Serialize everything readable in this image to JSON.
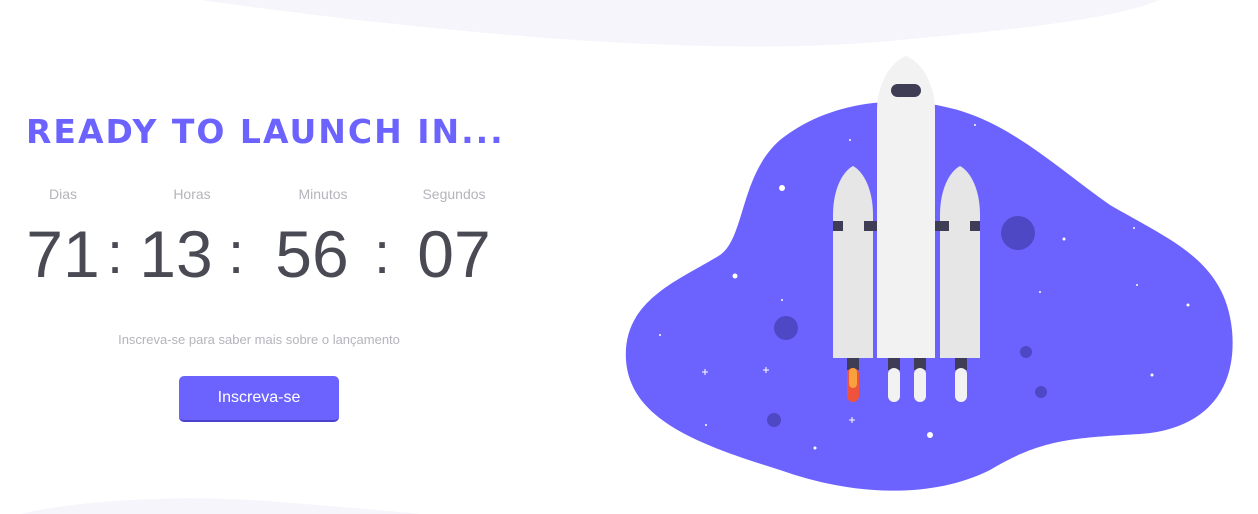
{
  "countdown": {
    "headline": "READY TO LAUNCH IN...",
    "labels": {
      "days": "Dias",
      "hours": "Horas",
      "minutes": "Minutos",
      "seconds": "Segundos"
    },
    "values": {
      "days": "71",
      "hours": "13",
      "minutes": "56",
      "seconds": "07"
    },
    "separator": ":"
  },
  "signup": {
    "text": "Inscreva-se para saber mais sobre o lançamento",
    "button_label": "Inscreva-se"
  },
  "colors": {
    "accent": "#6c63ff",
    "timer_text": "#4a4a55",
    "muted_text": "#b4b4bb",
    "rocket_body": "#f2f2f2",
    "flame": "#f0533c"
  },
  "icons": [
    "rocket-illustration",
    "space-blob"
  ]
}
